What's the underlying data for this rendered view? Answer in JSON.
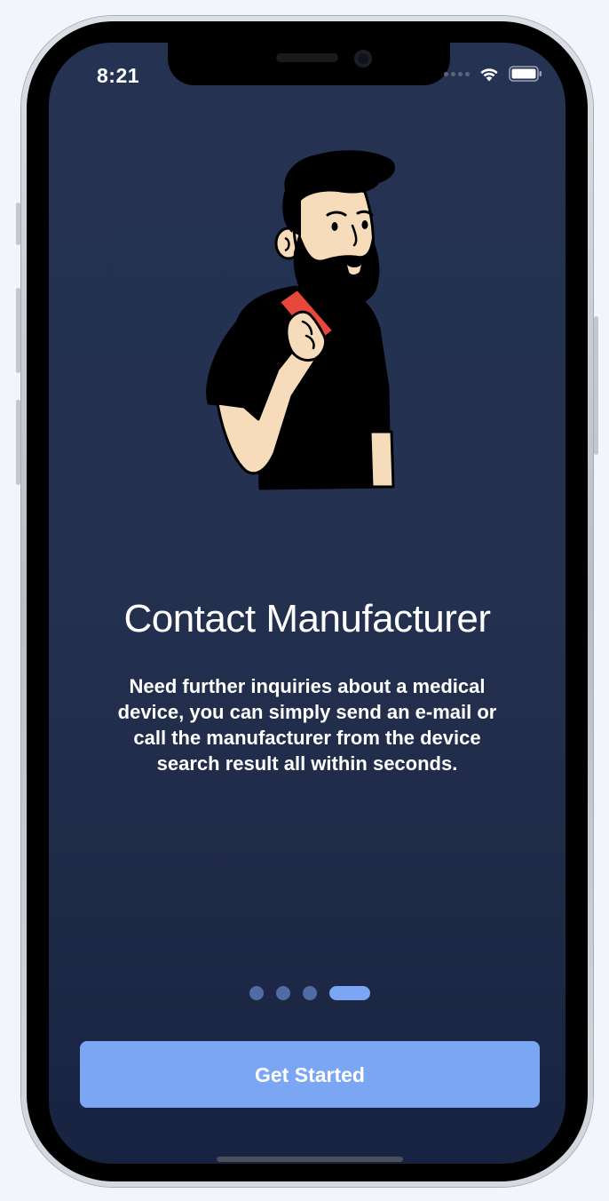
{
  "status_bar": {
    "time": "8:21",
    "icons": [
      "cellular-signal-icon",
      "wifi-icon",
      "battery-icon"
    ]
  },
  "onboarding": {
    "illustration": "bearded-man-holding-phone-illustration",
    "title": "Contact Manufacturer",
    "description": "Need further inquiries about a medical device, you can simply send an e-mail or call the manufacturer from the device search result all within seconds.",
    "pager": {
      "total_pages": 4,
      "current_page": 4
    },
    "cta_label": "Get Started"
  },
  "colors": {
    "background_top": "#253252",
    "background_bottom": "#172341",
    "accent": "#7aa6f4",
    "pager_inactive": "#4f6ca6",
    "text": "#ffffff",
    "phone_accent": "#e8473c",
    "skin": "#f7dcbb"
  }
}
